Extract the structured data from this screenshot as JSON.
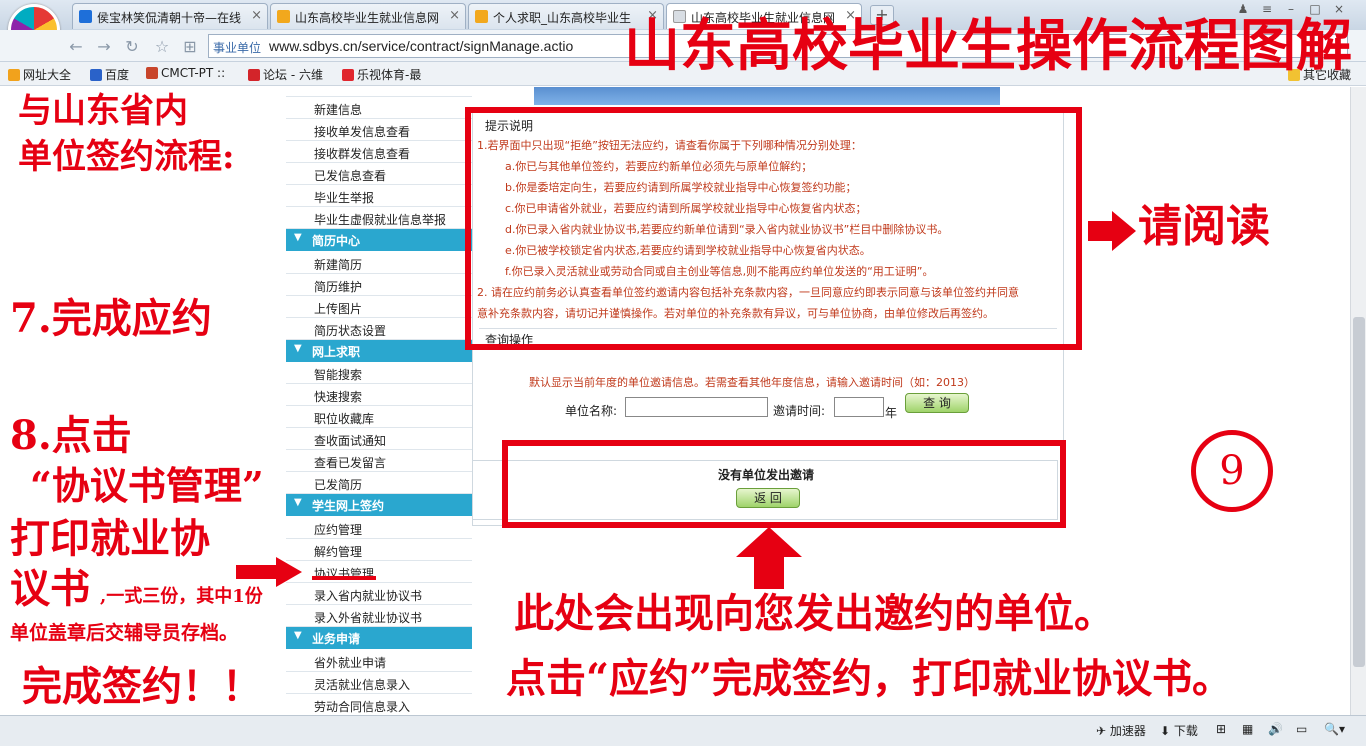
{
  "tabs": [
    {
      "label": "侯宝林笑侃清朝十帝—在线",
      "active": false
    },
    {
      "label": "山东高校毕业生就业信息网",
      "active": false
    },
    {
      "label": "个人求职_山东高校毕业生",
      "active": false
    },
    {
      "label": "山东高校毕业生就业信息网",
      "active": true
    }
  ],
  "new_tab": "+",
  "address": {
    "zone": "事业单位",
    "url": "www.sdbys.cn/service/contract/signManage.actio"
  },
  "bookmarks": [
    "网址大全",
    "百度",
    "CMCT-PT ::",
    "论坛 - 六维",
    "乐视体育-最",
    "其它收藏"
  ],
  "sidebar": {
    "items_top": [
      "新建信息",
      "接收单发信息查看",
      "接收群发信息查看",
      "已发信息查看",
      "毕业生举报",
      "毕业生虚假就业信息举报"
    ],
    "resume_head": "简历中心",
    "resume_items": [
      "新建简历",
      "简历维护",
      "上传图片",
      "简历状态设置"
    ],
    "jobs_head": "网上求职",
    "jobs_items": [
      "智能搜索",
      "快速搜索",
      "职位收藏库",
      "查收面试通知",
      "查看已发留言",
      "已发简历"
    ],
    "sign_head": "学生网上签约",
    "sign_items": [
      "应约管理",
      "解约管理",
      "协议书管理",
      "录入省内就业协议书",
      "录入外省就业协议书"
    ],
    "biz_head": "业务申请",
    "biz_items": [
      "省外就业申请",
      "灵活就业信息录入",
      "劳动合同信息录入"
    ]
  },
  "notice": {
    "title": "提示说明",
    "lines": [
      "1.若界面中只出现“拒绝”按钮无法应约，请查看你属于下列哪种情况分别处理：",
      "a.你已与其他单位签约，若要应约新单位必须先与原单位解约；",
      "b.你是委培定向生，若要应约请到所属学校就业指导中心恢复签约功能；",
      "c.你已申请省外就业，若要应约请到所属学校就业指导中心恢复省内状态；",
      "d.你已录入省内就业协议书,若要应约新单位请到“录入省内就业协议书”栏目中删除协议书。",
      "e.你已被学校锁定省内状态,若要应约请到学校就业指导中心恢复省内状态。",
      "f.你已录入灵活就业或劳动合同或自主创业等信息,则不能再应约单位发送的“用工证明”。",
      "2. 请在应约前务必认真查看单位签约邀请内容包括补充条款内容，一旦同意应约即表示同意与该单位签约并同意",
      "意补充条款内容，请切记并谨慎操作。若对单位的补充条款有异议，可与单位协商，由单位修改后再签约。"
    ]
  },
  "query": {
    "title": "查询操作",
    "hint": "默认显示当前年度的单位邀请信息。若需查看其他年度信息，请输入邀请时间（如：2013）",
    "unit_label": "单位名称:",
    "time_label": "邀请时间:",
    "year_label": "年",
    "search_button": "查 询"
  },
  "result": {
    "message": "没有单位发出邀请",
    "back_button": "返 回"
  },
  "annotations": {
    "banner_title": "山东高校毕业生操作流程图解",
    "left_title": [
      "与山东省内",
      "单位签约流程:"
    ],
    "step7": "7.完成应约",
    "step8": [
      "8.点击",
      "“协议书管理”"
    ],
    "print": [
      "打印就业协",
      "议书"
    ],
    "copies": ",一式三份，其中1份",
    "stamp": "单位盖章后交辅导员存档。",
    "done": "完成签约！！",
    "read": "请阅读",
    "circle": "9",
    "appear": "此处会出现向您发出邀约的单位。",
    "click": "点击“应约”完成签约，打印就业协议书。"
  },
  "statusbar": {
    "accelerator": "加速器",
    "download": "下载"
  },
  "colors": {
    "annotation_red": "#e60012",
    "menu_head": "#2aa7cf",
    "notice_text": "#c0391b"
  }
}
